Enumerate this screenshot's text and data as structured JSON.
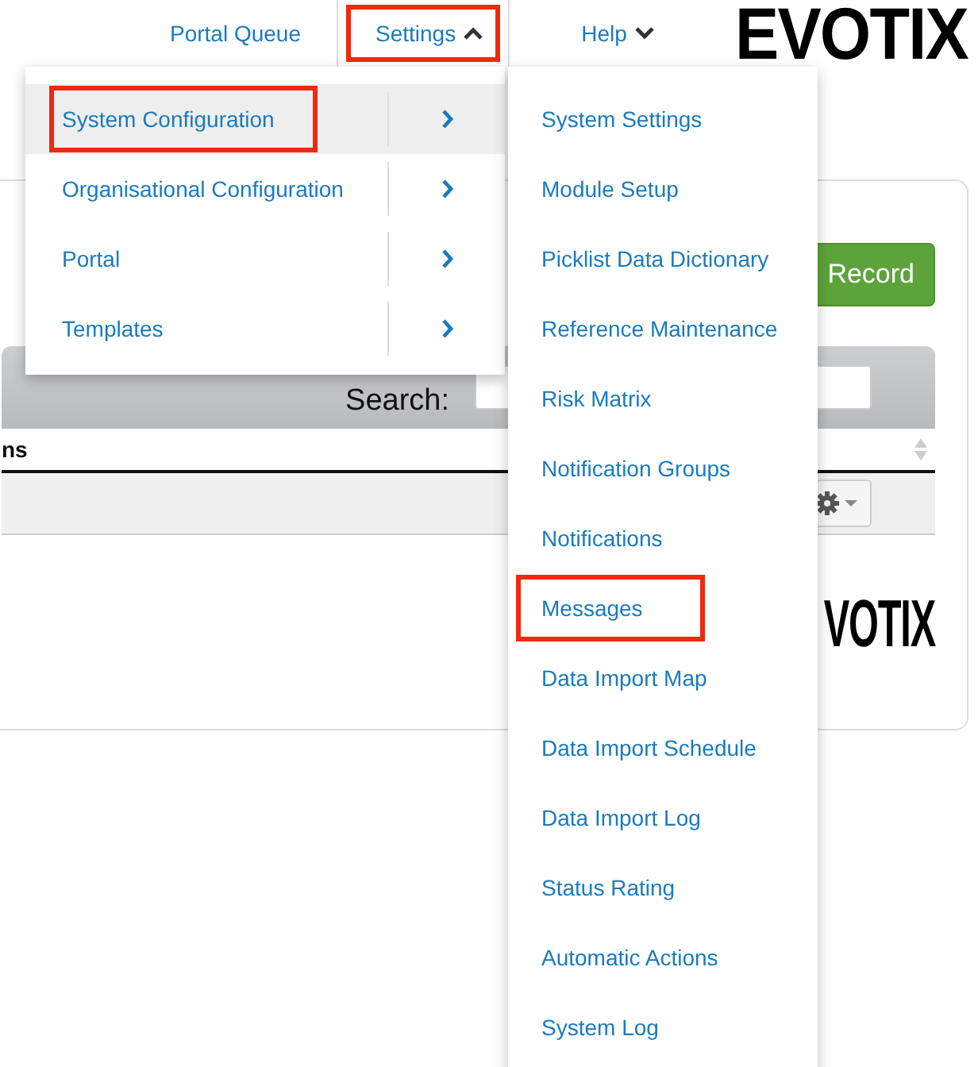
{
  "nav": [
    {
      "label": "Portal Queue",
      "kind": "link",
      "annotated": false
    },
    {
      "label": "Settings",
      "kind": "dropdown",
      "expanded": true,
      "annotated": true
    },
    {
      "label": "Help",
      "kind": "dropdown",
      "expanded": false,
      "annotated": false
    }
  ],
  "logo": "EVOTIX",
  "settings_menu": {
    "categories": [
      {
        "label": "System Configuration",
        "selected": true,
        "annotated": true
      },
      {
        "label": "Organisational Configuration",
        "selected": false,
        "annotated": false
      },
      {
        "label": "Portal",
        "selected": false,
        "annotated": false
      },
      {
        "label": "Templates",
        "selected": false,
        "annotated": false
      }
    ],
    "items": [
      {
        "label": "System Settings",
        "annotated": false
      },
      {
        "label": "Module Setup",
        "annotated": false
      },
      {
        "label": "Picklist Data Dictionary",
        "annotated": false
      },
      {
        "label": "Reference Maintenance",
        "annotated": false
      },
      {
        "label": "Risk Matrix",
        "annotated": false
      },
      {
        "label": "Notification Groups",
        "annotated": false
      },
      {
        "label": "Notifications",
        "annotated": false
      },
      {
        "label": "Messages",
        "annotated": true
      },
      {
        "label": "Data Import Map",
        "annotated": false
      },
      {
        "label": "Data Import Schedule",
        "annotated": false
      },
      {
        "label": "Data Import Log",
        "annotated": false
      },
      {
        "label": "Status Rating",
        "annotated": false
      },
      {
        "label": "Automatic Actions",
        "annotated": false
      },
      {
        "label": "System Log",
        "annotated": false
      }
    ]
  },
  "page": {
    "record_button": "Record",
    "search_label": "Search:",
    "table": {
      "column_1": "ns"
    },
    "footer_logo": "VOTIX"
  }
}
